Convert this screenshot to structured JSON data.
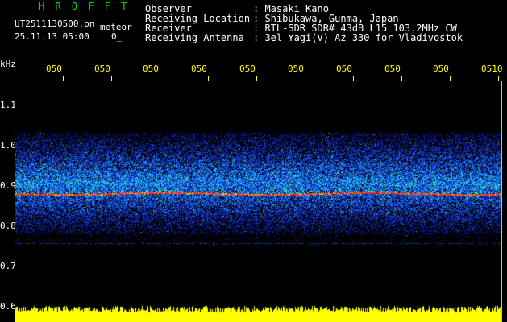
{
  "app": {
    "title_letters": "H R O F F T",
    "filename": "UT2511130500.pn",
    "tag": "meteor",
    "datetime": "25.11.13 05:00",
    "sub_value": "0_"
  },
  "info": {
    "labels": [
      "Observer",
      "Receiving Location",
      "Receiver",
      "Receiving Antenna"
    ],
    "values": [
      ": Masaki Kano",
      ": Shibukawa, Gunma, Japan",
      ": RTL-SDR SDR# 43dB L15 103.2MHz CW",
      ": 3el Yagi(V) Az 330 for Vladivostok"
    ]
  },
  "axis": {
    "unit": "kHz",
    "y_ticks": [
      "1.1",
      "1.0",
      "0.9",
      "0.8",
      "0.7",
      "0.6"
    ],
    "x_ticks": [
      "050",
      "050",
      "050",
      "050",
      "050",
      "050",
      "050",
      "050",
      "050",
      "0510"
    ]
  },
  "colors": {
    "background": "#000000",
    "title_green": "#00e000",
    "text_white": "#ffffff",
    "axis_yellow": "#ffff00",
    "signal_red": "#ff3030"
  }
}
